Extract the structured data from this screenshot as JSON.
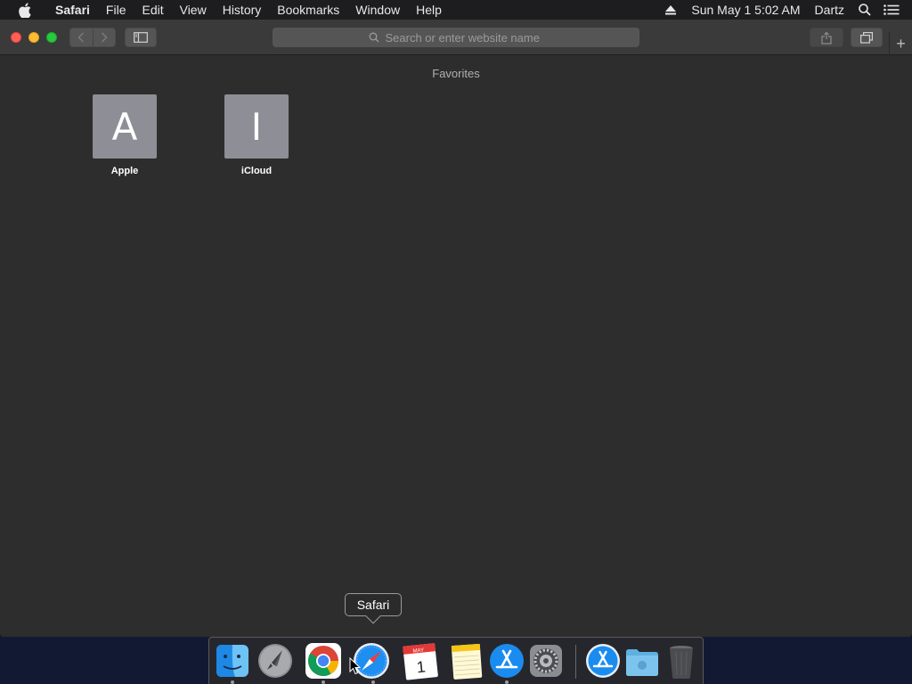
{
  "menubar": {
    "apple_icon": "apple-logo-icon",
    "app_name": "Safari",
    "items": [
      "File",
      "Edit",
      "View",
      "History",
      "Bookmarks",
      "Window",
      "Help"
    ],
    "clock": "Sun May 1  5:02 AM",
    "user": "Dartz",
    "status_icons": [
      "eject-icon",
      "spotlight-search-icon",
      "notification-center-icon"
    ]
  },
  "toolbar": {
    "address_placeholder": "Search or enter website name",
    "new_tab_label": "+"
  },
  "favorites": {
    "title": "Favorites",
    "items": [
      {
        "letter": "A",
        "label": "Apple"
      },
      {
        "letter": "I",
        "label": "iCloud"
      }
    ]
  },
  "tooltip": {
    "label": "Safari"
  },
  "dock": {
    "apps": [
      {
        "name": "Finder",
        "icon": "finder-icon",
        "running": true
      },
      {
        "name": "Launchpad",
        "icon": "launchpad-icon",
        "running": false
      },
      {
        "name": "Google Chrome",
        "icon": "chrome-icon",
        "running": true
      },
      {
        "name": "Safari",
        "icon": "safari-icon",
        "running": true
      },
      {
        "name": "Calendar",
        "icon": "calendar-icon",
        "running": false,
        "month": "MAY",
        "day": "1"
      },
      {
        "name": "Notes",
        "icon": "notes-icon",
        "running": false
      },
      {
        "name": "App Store",
        "icon": "app-store-icon",
        "running": true
      },
      {
        "name": "System Preferences",
        "icon": "system-preferences-icon",
        "running": false
      },
      {
        "name": "Downloads",
        "icon": "app-store-downloads-icon",
        "running": false
      },
      {
        "name": "Folder",
        "icon": "folder-icon",
        "running": false
      },
      {
        "name": "Trash",
        "icon": "trash-icon",
        "running": false
      }
    ]
  },
  "colors": {
    "window_bg": "#2d2d2d",
    "toolbar_bg": "#3a3a3a",
    "tile_bg": "#8e8e96",
    "desktop_bg": "#121a33"
  }
}
